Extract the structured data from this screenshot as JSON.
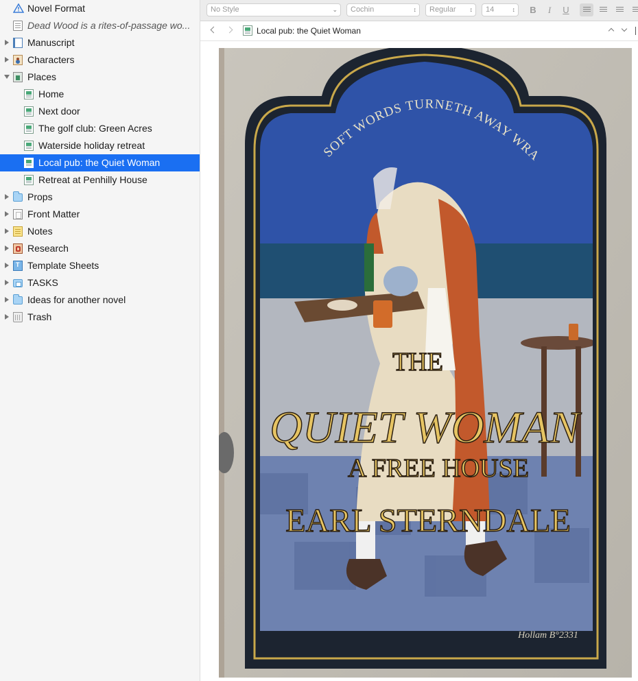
{
  "binder": {
    "items": [
      {
        "label": "Novel Format",
        "icon": "warning-icon",
        "level": 0,
        "disclosure": "none",
        "italic": false,
        "selected": false
      },
      {
        "label": "Dead Wood is a rites-of-passage wo...",
        "icon": "synopsis-doc-icon",
        "level": 0,
        "disclosure": "none",
        "italic": true,
        "selected": false
      },
      {
        "label": "Manuscript",
        "icon": "manuscript-icon",
        "level": 0,
        "disclosure": "closed",
        "italic": false,
        "selected": false
      },
      {
        "label": "Characters",
        "icon": "characters-icon",
        "level": 0,
        "disclosure": "closed",
        "italic": false,
        "selected": false
      },
      {
        "label": "Places",
        "icon": "places-icon",
        "level": 0,
        "disclosure": "open",
        "italic": false,
        "selected": false
      },
      {
        "label": "Home",
        "icon": "setting-sheet-icon",
        "level": 1,
        "disclosure": "none",
        "italic": false,
        "selected": false
      },
      {
        "label": "Next door",
        "icon": "setting-sheet-icon",
        "level": 1,
        "disclosure": "none",
        "italic": false,
        "selected": false
      },
      {
        "label": "The golf club: Green Acres",
        "icon": "setting-sheet-icon",
        "level": 1,
        "disclosure": "none",
        "italic": false,
        "selected": false
      },
      {
        "label": "Waterside holiday retreat",
        "icon": "setting-sheet-icon",
        "level": 1,
        "disclosure": "none",
        "italic": false,
        "selected": false
      },
      {
        "label": "Local pub: the Quiet Woman",
        "icon": "setting-sheet-icon",
        "level": 1,
        "disclosure": "none",
        "italic": false,
        "selected": true
      },
      {
        "label": "Retreat at Penhilly House",
        "icon": "setting-sheet-icon",
        "level": 1,
        "disclosure": "none",
        "italic": false,
        "selected": false
      },
      {
        "label": "Props",
        "icon": "folder-icon",
        "level": 0,
        "disclosure": "closed",
        "italic": false,
        "selected": false
      },
      {
        "label": "Front Matter",
        "icon": "front-matter-icon",
        "level": 0,
        "disclosure": "closed",
        "italic": false,
        "selected": false
      },
      {
        "label": "Notes",
        "icon": "notes-icon",
        "level": 0,
        "disclosure": "closed",
        "italic": false,
        "selected": false
      },
      {
        "label": "Research",
        "icon": "research-icon",
        "level": 0,
        "disclosure": "closed",
        "italic": false,
        "selected": false
      },
      {
        "label": "Template Sheets",
        "icon": "template-sheets-icon",
        "level": 0,
        "disclosure": "closed",
        "italic": false,
        "selected": false
      },
      {
        "label": "TASKS",
        "icon": "tasks-folder-icon",
        "level": 0,
        "disclosure": "closed",
        "italic": false,
        "selected": false
      },
      {
        "label": "Ideas for another novel",
        "icon": "folder-icon",
        "level": 0,
        "disclosure": "closed",
        "italic": false,
        "selected": false
      },
      {
        "label": "Trash",
        "icon": "trash-icon",
        "level": 0,
        "disclosure": "closed",
        "italic": false,
        "selected": false
      }
    ]
  },
  "formatbar": {
    "style_select": "No Style",
    "font_select": "Cochin",
    "weight_select": "Regular",
    "size_select": "14",
    "bold": "B",
    "italic": "I",
    "underline": "U",
    "active_alignment": "left"
  },
  "header": {
    "doc_title": "Local pub: the Quiet Woman"
  },
  "sign": {
    "arch_text": "SOFT WORDS TURNETH AWAY WRATH.",
    "line1": "THE",
    "line2": "QUIET WOMAN",
    "line3": "A FREE HOUSE",
    "line4": "EARL STERNDALE",
    "signature": "Hollam B°2331"
  },
  "colors": {
    "selection": "#1a6ff2",
    "sign_frame": "#1c2430",
    "sign_gold": "#e6c463",
    "sign_sky": "#2f53a8"
  }
}
